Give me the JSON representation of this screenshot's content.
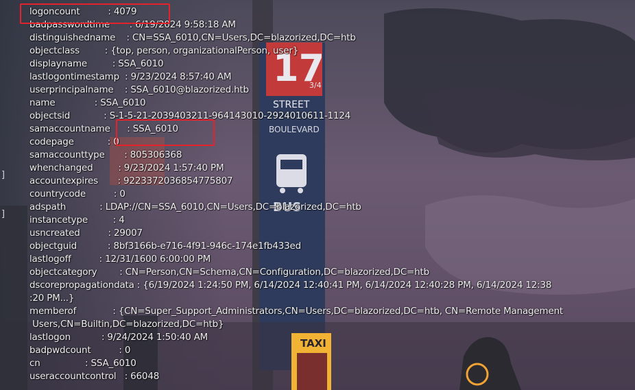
{
  "properties": [
    {
      "key": "logoncount",
      "sep": "          : ",
      "value": "4079"
    },
    {
      "key": "badpasswordtime",
      "sep": "       : ",
      "value": "6/19/2024 9:58:18 AM"
    },
    {
      "key": "distinguishedname",
      "sep": "    : ",
      "value": "CN=SSA_6010,CN=Users,DC=blazorized,DC=htb"
    },
    {
      "key": "objectclass",
      "sep": "         : ",
      "value": "{top, person, organizationalPerson, user}"
    },
    {
      "key": "displayname",
      "sep": "         : ",
      "value": "SSA_6010"
    },
    {
      "key": "lastlogontimestamp",
      "sep": "  : ",
      "value": "9/23/2024 8:57:40 AM"
    },
    {
      "key": "userprincipalname",
      "sep": "    : ",
      "value": "SSA_6010@blazorized.htb"
    },
    {
      "key": "name",
      "sep": "              : ",
      "value": "SSA_6010"
    },
    {
      "key": "objectsid",
      "sep": "            : ",
      "value": "S-1-5-21-2039403211-964143010-2924010611-1124"
    },
    {
      "key": "samaccountname",
      "sep": "      : ",
      "value": "SSA_6010"
    },
    {
      "key": "codepage",
      "sep": "            : ",
      "value": "0"
    },
    {
      "key": "samaccounttype",
      "sep": "       : ",
      "value": "805306368"
    },
    {
      "key": "whenchanged",
      "sep": "         : ",
      "value": "9/23/2024 1:57:40 PM"
    },
    {
      "key": "accountexpires",
      "sep": "       : ",
      "value": "9223372036854775807"
    },
    {
      "key": "countrycode",
      "sep": "          : ",
      "value": "0"
    },
    {
      "key": "adspath",
      "sep": "            : ",
      "value": "LDAP://CN=SSA_6010,CN=Users,DC=blazorized,DC=htb"
    },
    {
      "key": "instancetype",
      "sep": "         : ",
      "value": "4"
    },
    {
      "key": "usncreated",
      "sep": "          : ",
      "value": "29007"
    },
    {
      "key": "objectguid",
      "sep": "           : ",
      "value": "8bf3166b-e716-4f91-946c-174e1fb433ed"
    },
    {
      "key": "lastlogoff",
      "sep": "          : ",
      "value": "12/31/1600 6:00:00 PM"
    },
    {
      "key": "objectcategory",
      "sep": "        : ",
      "value": "CN=Person,CN=Schema,CN=Configuration,DC=blazorized,DC=htb"
    },
    {
      "key": "dscorepropagationdata",
      "sep": " : ",
      "value": "{6/19/2024 1:24:50 PM, 6/14/2024 12:40:41 PM, 6/14/2024 12:40:28 PM, 6/14/2024 12:38\n:20 PM...}"
    },
    {
      "key": "memberof",
      "sep": "             : ",
      "value": "{CN=Super_Support_Administrators,CN=Users,DC=blazorized,DC=htb, CN=Remote Management\n Users,CN=Builtin,DC=blazorized,DC=htb}"
    },
    {
      "key": "lastlogon",
      "sep": "           : ",
      "value": "9/24/2024 1:50:40 AM"
    },
    {
      "key": "badpwdcount",
      "sep": "          : ",
      "value": "0"
    },
    {
      "key": "cn",
      "sep": "                : ",
      "value": "SSA_6010"
    },
    {
      "key": "useraccountcontrol",
      "sep": "   : ",
      "value": "66048"
    }
  ],
  "background_signs": {
    "street_number": "17",
    "street_fraction": "3/4",
    "street_word": "STREET",
    "boulevard_word": "BOULEVARD",
    "bus_word": "BUS",
    "taxi_word": "TAXI"
  },
  "edge_glyphs": [
    "]",
    "]"
  ],
  "colors": {
    "highlight": "#e5222b",
    "text": "#eeeeee",
    "sign_panel": "#2e3b5c",
    "sign_red": "#c23a3a",
    "taxi_yellow": "#f2b233"
  }
}
